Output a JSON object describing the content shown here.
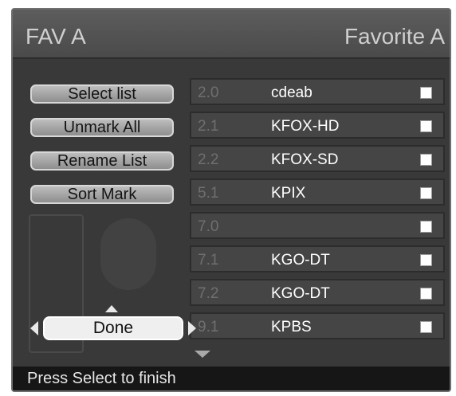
{
  "header": {
    "left_title": "FAV A",
    "right_title": "Favorite A"
  },
  "actions": [
    {
      "label": "Select list"
    },
    {
      "label": "Unmark All"
    },
    {
      "label": "Rename List"
    },
    {
      "label": "Sort Mark"
    }
  ],
  "done": {
    "label": "Done"
  },
  "channels": [
    {
      "number": "2.0",
      "name": "cdeab",
      "checked": false
    },
    {
      "number": "2.1",
      "name": "KFOX-HD",
      "checked": false
    },
    {
      "number": "2.2",
      "name": "KFOX-SD",
      "checked": false
    },
    {
      "number": "5.1",
      "name": "KPIX",
      "checked": false
    },
    {
      "number": "7.0",
      "name": "",
      "checked": false
    },
    {
      "number": "7.1",
      "name": "KGO-DT",
      "checked": false
    },
    {
      "number": "7.2",
      "name": "KGO-DT",
      "checked": false
    },
    {
      "number": "9.1",
      "name": "KPBS",
      "checked": false
    }
  ],
  "status": {
    "message": "Press Select to finish"
  },
  "icons": {
    "up": "arrow-up-icon",
    "down": "arrow-down-icon",
    "left": "arrow-left-icon",
    "right": "arrow-right-icon",
    "checkbox": "checkbox-icon"
  }
}
